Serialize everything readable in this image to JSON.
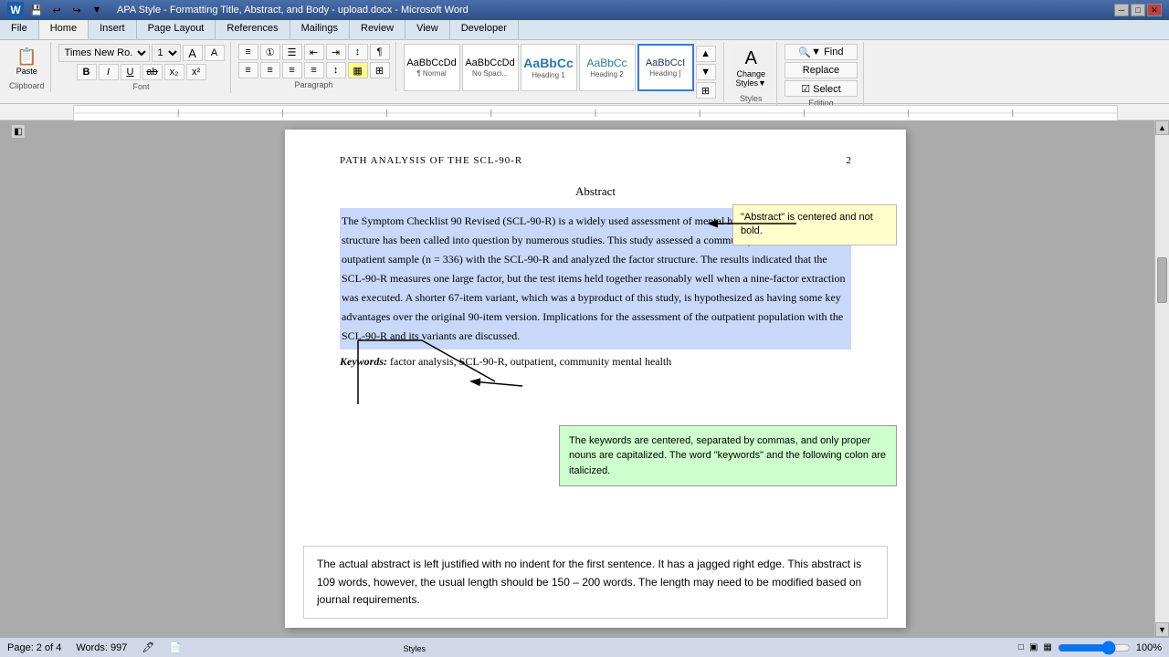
{
  "titleBar": {
    "title": "APA Style - Formatting Title, Abstract, and Body - upload.docx - Microsoft Word",
    "minBtn": "─",
    "maxBtn": "□",
    "closeBtn": "✕"
  },
  "ribbonTabs": [
    "File",
    "Home",
    "Insert",
    "Page Layout",
    "References",
    "Mailings",
    "Review",
    "View",
    "Developer"
  ],
  "activeTab": "Home",
  "quickAccess": [
    "💾",
    "↩",
    "↪",
    "▼"
  ],
  "formatToolbar": {
    "font": "Times New Ro...",
    "size": "12",
    "boldBtn": "B",
    "italicBtn": "I",
    "underlineBtn": "U",
    "strikeBtn": "ab",
    "subscriptBtn": "x₂",
    "superscriptBtn": "x²"
  },
  "styles": [
    {
      "id": "normal",
      "preview": "AaBbCcDd",
      "label": "¶ Normal"
    },
    {
      "id": "no-spacing",
      "preview": "AaBbCcDd",
      "label": "No Spaci..."
    },
    {
      "id": "heading1",
      "preview": "AaBbCc",
      "label": "Heading 1",
      "selected": false
    },
    {
      "id": "heading2",
      "preview": "AaBbCc",
      "label": "Heading 2"
    },
    {
      "id": "heading3",
      "preview": "AaBbCc",
      "label": "Heading 3"
    }
  ],
  "editingGroup": {
    "findLabel": "▼ Find",
    "replaceLabel": "Replace",
    "selectLabel": "☑ Select"
  },
  "page": {
    "headerLeft": "PATH ANALYSIS OF THE SCL-90-R",
    "headerRight": "2",
    "abstractTitle": "Abstract",
    "abstractAnnotation": "\"Abstract\" is centered  and not bold.",
    "abstractBody": "The Symptom Checklist 90 Revised (SCL-90-R) is a widely used assessment of mental health pathology. Its factor structure has been called into question by numerous studies. This study assessed a community mental health outpatient sample (n = 336) with the SCL-90-R and analyzed the factor structure. The results indicated that the SCL-90-R measures one large factor, but the test items held together reasonably well when a nine-factor extraction was executed. A shorter 67-item variant, which was a byproduct of this study, is hypothesized as having some key advantages over the original 90-item version. Implications for the assessment of the outpatient population with the SCL-90-R and its variants are discussed.",
    "keywordsLabel": "Keywords:",
    "keywordsText": " factor analysis, SCL-90-R, outpatient, community mental health",
    "keywordsAnnotation": "The keywords are centered, separated by commas, and only proper nouns are capitalized. The word \"keywords\" and the following colon are italicized.",
    "infoBox": "The actual abstract is left justified with no indent for the first sentence. It has a jagged right edge. This abstract is 109 words, however, the usual length should be 150 – 200 words. The length may need to be modified based on journal requirements."
  },
  "statusBar": {
    "page": "Page: 2 of 4",
    "words": "Words: 997",
    "icons": [
      "🖊",
      "📄"
    ],
    "zoomIcons": [
      "□",
      "▣",
      "▦"
    ],
    "zoom": "─────────────",
    "zoomLevel": "─"
  }
}
